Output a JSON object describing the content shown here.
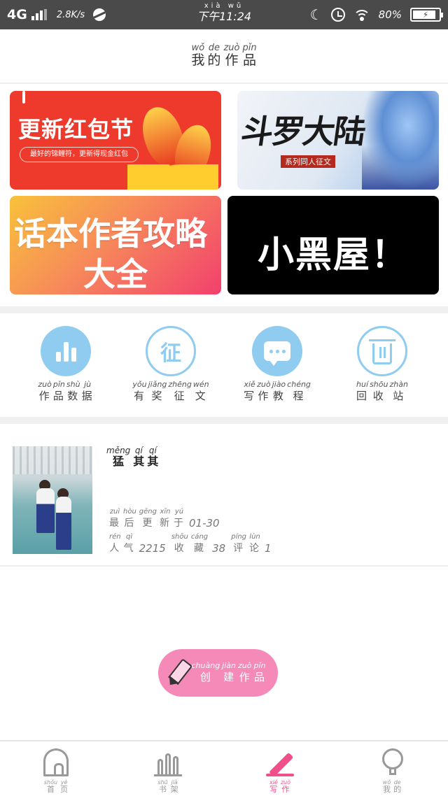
{
  "status_bar": {
    "network": "4G",
    "speed": "2.8K/s",
    "time_pinyin": "xià  wǔ",
    "time": "下午11:24",
    "battery": "80%"
  },
  "header": {
    "title": [
      {
        "py": "wǒ",
        "hz": "我"
      },
      {
        "py": "de",
        "hz": "的"
      },
      {
        "py": "zuò",
        "hz": "作"
      },
      {
        "py": "pǐn",
        "hz": "品"
      }
    ]
  },
  "banners": {
    "hongbao": {
      "title": "更新红包节",
      "subtitle": "最好的锦鲤符，更新得现金红包"
    },
    "douluo": {
      "title": "斗罗大陆",
      "subtitle": "系列同人征文"
    },
    "guide": {
      "line1": "话本作者攻略",
      "line2": "大全"
    },
    "xiaoheiwu": {
      "title": "小黑屋！"
    }
  },
  "features": [
    {
      "icon": "bar-chart-icon",
      "chars": [
        {
          "py": "zuò",
          "hz": "作"
        },
        {
          "py": "pǐn",
          "hz": "品"
        },
        {
          "py": "shù",
          "hz": "数"
        },
        {
          "py": "jù",
          "hz": "据"
        }
      ]
    },
    {
      "icon": "zheng-icon",
      "glyph": "征",
      "chars": [
        {
          "py": "yǒu",
          "hz": "有"
        },
        {
          "py": "jiǎng",
          "hz": "奖"
        },
        {
          "py": "zhēng",
          "hz": "征"
        },
        {
          "py": "wén",
          "hz": "文"
        }
      ]
    },
    {
      "icon": "chat-bubble-icon",
      "chars": [
        {
          "py": "xiě",
          "hz": "写"
        },
        {
          "py": "zuò",
          "hz": "作"
        },
        {
          "py": "jiào",
          "hz": "教"
        },
        {
          "py": "chéng",
          "hz": "程"
        }
      ]
    },
    {
      "icon": "trash-icon",
      "chars": [
        {
          "py": "huí",
          "hz": "回"
        },
        {
          "py": "shōu",
          "hz": "收"
        },
        {
          "py": "zhàn",
          "hz": "站"
        }
      ]
    }
  ],
  "work": {
    "title": [
      {
        "py": "měng",
        "hz": "猛"
      },
      {
        "py": "qí",
        "hz": "其"
      },
      {
        "py": "qí",
        "hz": "其"
      }
    ],
    "updated_label": [
      {
        "py": "zuì",
        "hz": "最"
      },
      {
        "py": "hòu",
        "hz": "后"
      },
      {
        "py": "gēng",
        "hz": "更"
      },
      {
        "py": "xīn",
        "hz": "新"
      },
      {
        "py": "yú",
        "hz": "于"
      }
    ],
    "updated_value": "01-30",
    "popularity_label": [
      {
        "py": "rén",
        "hz": "人"
      },
      {
        "py": "qì",
        "hz": "气"
      }
    ],
    "popularity_value": "2215",
    "favorites_label": [
      {
        "py": "shōu",
        "hz": "收"
      },
      {
        "py": "cáng",
        "hz": "藏"
      }
    ],
    "favorites_value": "38",
    "comments_label": [
      {
        "py": "píng",
        "hz": "评"
      },
      {
        "py": "lùn",
        "hz": "论"
      }
    ],
    "comments_value": "1"
  },
  "create_button": [
    {
      "py": "chuàng",
      "hz": "创"
    },
    {
      "py": "jiàn",
      "hz": "建"
    },
    {
      "py": "zuò",
      "hz": "作"
    },
    {
      "py": "pǐn",
      "hz": "品"
    }
  ],
  "bottom_nav": [
    {
      "icon": "home-icon",
      "chars": [
        {
          "py": "shǒu",
          "hz": "首"
        },
        {
          "py": "yè",
          "hz": "页"
        }
      ]
    },
    {
      "icon": "bookshelf-icon",
      "chars": [
        {
          "py": "shū",
          "hz": "书"
        },
        {
          "py": "jià",
          "hz": "架"
        }
      ]
    },
    {
      "icon": "write-icon",
      "active": true,
      "chars": [
        {
          "py": "xiě",
          "hz": "写"
        },
        {
          "py": "zuò",
          "hz": "作"
        }
      ]
    },
    {
      "icon": "profile-icon",
      "chars": [
        {
          "py": "wǒ",
          "hz": "我"
        },
        {
          "py": "de",
          "hz": "的"
        }
      ]
    }
  ],
  "colors": {
    "accent_blue": "#8fccf0",
    "accent_pink": "#f0508a",
    "create_pink": "#f58ab8",
    "status_bar": "#4a4a4a"
  }
}
